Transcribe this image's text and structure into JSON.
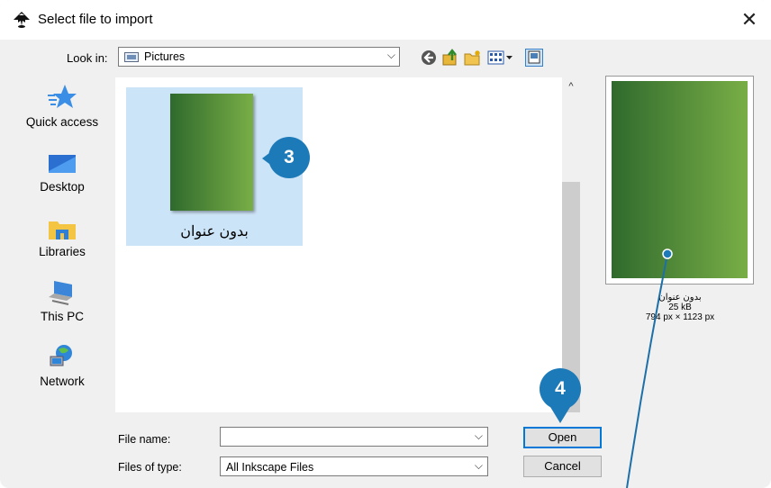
{
  "window": {
    "title": "Select file to import",
    "close_symbol": "✕"
  },
  "lookin": {
    "label": "Look in:",
    "value": "Pictures",
    "arrow": "⌵"
  },
  "toolbar": [
    {
      "name": "back-icon"
    },
    {
      "name": "up-folder-icon"
    },
    {
      "name": "new-folder-icon"
    },
    {
      "name": "view-menu-icon"
    },
    {
      "name": "preview-toggle-icon"
    }
  ],
  "sidebar": {
    "items": [
      {
        "label": "Quick access",
        "icon": "star-icon"
      },
      {
        "label": "Desktop",
        "icon": "desktop-icon"
      },
      {
        "label": "Libraries",
        "icon": "libraries-icon"
      },
      {
        "label": "This PC",
        "icon": "computer-icon"
      },
      {
        "label": "Network",
        "icon": "network-icon"
      }
    ]
  },
  "files": [
    {
      "name": "بدون عنوان"
    }
  ],
  "scrollbar": {
    "up_symbol": "^"
  },
  "preview": {
    "name": "بدون عنوان",
    "size": "25 kB",
    "dimensions": "794 px × 1123 px"
  },
  "file_name": {
    "label": "File name:",
    "value": "",
    "arrow": "⌵"
  },
  "file_type": {
    "label": "Files of type:",
    "value": "All Inkscape Files",
    "arrow": "⌵"
  },
  "buttons": {
    "open": "Open",
    "cancel": "Cancel"
  },
  "annotations": {
    "step3": "3",
    "step4": "4"
  },
  "colors": {
    "badge": "#1d7ab8",
    "selection": "#cce4f7",
    "thumb_dark": "#2f6a2d",
    "thumb_light": "#79ae46"
  }
}
